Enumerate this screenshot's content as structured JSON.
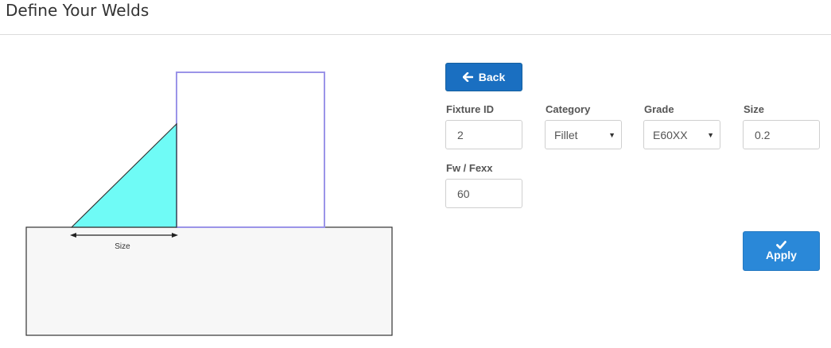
{
  "page": {
    "title": "Define Your Welds"
  },
  "diagram": {
    "size_label": "Size"
  },
  "form": {
    "back_label": "Back",
    "fixture_id": {
      "label": "Fixture ID",
      "value": "2"
    },
    "category": {
      "label": "Category",
      "value": "Fillet"
    },
    "grade": {
      "label": "Grade",
      "value": "E60XX"
    },
    "size": {
      "label": "Size",
      "value": "0.2"
    },
    "fw_fexx": {
      "label": "Fw / Fexx",
      "value": "60"
    },
    "apply_label": "Apply"
  },
  "icons": {
    "back": "arrow-left-icon",
    "apply": "checkmark-icon"
  },
  "colors": {
    "primary_button": "#1a6fc1",
    "apply_button": "#2a88d8",
    "weld_fill": "#6ffbf6",
    "vertical_plate_stroke": "#9b94e8",
    "base_plate_fill": "#f7f7f7"
  }
}
